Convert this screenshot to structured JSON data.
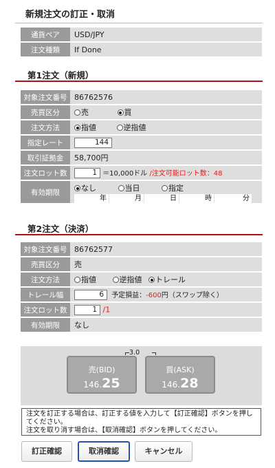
{
  "page_title": "新規注文の訂正・取消",
  "summary": {
    "pair_label": "通貨ペア",
    "pair_value": "USD/JPY",
    "type_label": "注文種類",
    "type_value": "If Done"
  },
  "order1": {
    "title": "第1注文（新規）",
    "order_no_label": "対象注文番号",
    "order_no": "86762576",
    "side_label": "売買区分",
    "side_sell": "売",
    "side_buy": "買",
    "method_label": "注文方法",
    "method_limit": "指値",
    "method_stop": "逆指値",
    "rate_label": "指定レート",
    "rate_value": "144",
    "margin_label": "取引証拠金",
    "margin_value": "58,700円",
    "lot_label": "注文ロット数",
    "lot_value": "1",
    "lot_unit": "＝10,000ドル",
    "lot_available": "/注文可能ロット数：48",
    "expiry_label": "有効期限",
    "expiry_none": "なし",
    "expiry_today": "当日",
    "expiry_specified": "指定",
    "expiry_units": [
      "年",
      "月",
      "日",
      "時",
      "分"
    ]
  },
  "order2": {
    "title": "第2注文（決済）",
    "order_no_label": "対象注文番号",
    "order_no": "86762577",
    "side_label": "売買区分",
    "side_value": "売",
    "method_label": "注文方法",
    "method_limit": "指値",
    "method_stop": "逆指値",
    "method_trail": "トレール",
    "trail_label": "トレール幅",
    "trail_value": "6",
    "pl_label": "予定損益：",
    "pl_value": "-600",
    "pl_suffix": "円（スワップ除く）",
    "lot_label": "注文ロット数",
    "lot_value": "1",
    "lot_max": "/1",
    "expiry_label": "有効期限",
    "expiry_value": "なし"
  },
  "rates": {
    "spread": "3.0",
    "bid_label": "売(BID)",
    "bid_prefix": "146.",
    "bid_suffix": "25",
    "ask_label": "買(ASK)",
    "ask_prefix": "146.",
    "ask_suffix": "28"
  },
  "notice_line1": "注文を訂正する場合は、訂正する値を入力して【訂正確認】ボタンを押してください。",
  "notice_line2": "注文を取り消す場合は、【取消確認】ボタンを押してください。",
  "buttons": {
    "confirm_edit": "訂正確認",
    "confirm_cancel": "取消確認",
    "cancel": "キャンセル"
  },
  "colors": {
    "accent_red": "#b01010",
    "primary_border": "#1f56a8",
    "label_bg": "#9a9a9a"
  }
}
